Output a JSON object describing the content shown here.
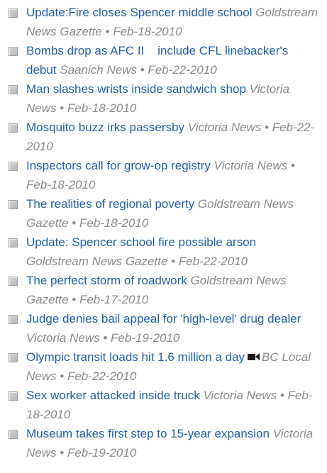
{
  "news": {
    "items": [
      {
        "headline": "Update:Fire closes Spencer middle school",
        "source": "Goldstream News Gazette",
        "date": "Feb-18-2010",
        "has_video": false
      },
      {
        "headline": "Bombs drop as AFC II    include CFL linebacker's debut",
        "source": "Saanich News",
        "date": "Feb-22-2010",
        "has_video": false
      },
      {
        "headline": "Man slashes wrists inside sandwich shop",
        "source": "Victoria News",
        "date": "Feb-18-2010",
        "has_video": false
      },
      {
        "headline": "Mosquito buzz irks passersby",
        "source": "Victoria News",
        "date": "Feb-22-2010",
        "has_video": false
      },
      {
        "headline": "Inspectors call for grow-op registry",
        "source": "Victoria News",
        "date": "Feb-18-2010",
        "has_video": false
      },
      {
        "headline": "The realities of regional poverty",
        "source": "Goldstream News Gazette",
        "date": "Feb-18-2010",
        "has_video": false
      },
      {
        "headline": "Update: Spencer school fire possible arson",
        "source": "Goldstream News Gazette",
        "date": "Feb-22-2010",
        "has_video": false
      },
      {
        "headline": "The perfect storm of roadwork",
        "source": "Goldstream News Gazette",
        "date": "Feb-17-2010",
        "has_video": false
      },
      {
        "headline": "Judge denies bail appeal for 'high-level' drug dealer",
        "source": "Victoria News",
        "date": "Feb-19-2010",
        "has_video": false
      },
      {
        "headline": "Olympic transit loads hit 1.6 million a day",
        "source": "BC Local News",
        "date": "Feb-22-2010",
        "has_video": true,
        "video_icon": "video-camera-icon"
      },
      {
        "headline": "Sex worker attacked inside truck",
        "source": "Victoria News",
        "date": "Feb-18-2010",
        "has_video": false
      },
      {
        "headline": "Museum takes first step to 15-year expansion",
        "source": "Victoria News",
        "date": "Feb-19-2010",
        "has_video": false
      }
    ],
    "separator": "•",
    "colors": {
      "link": "#1f5fae",
      "meta": "#8a8a8a",
      "bullet": "#c4c4c4"
    }
  }
}
